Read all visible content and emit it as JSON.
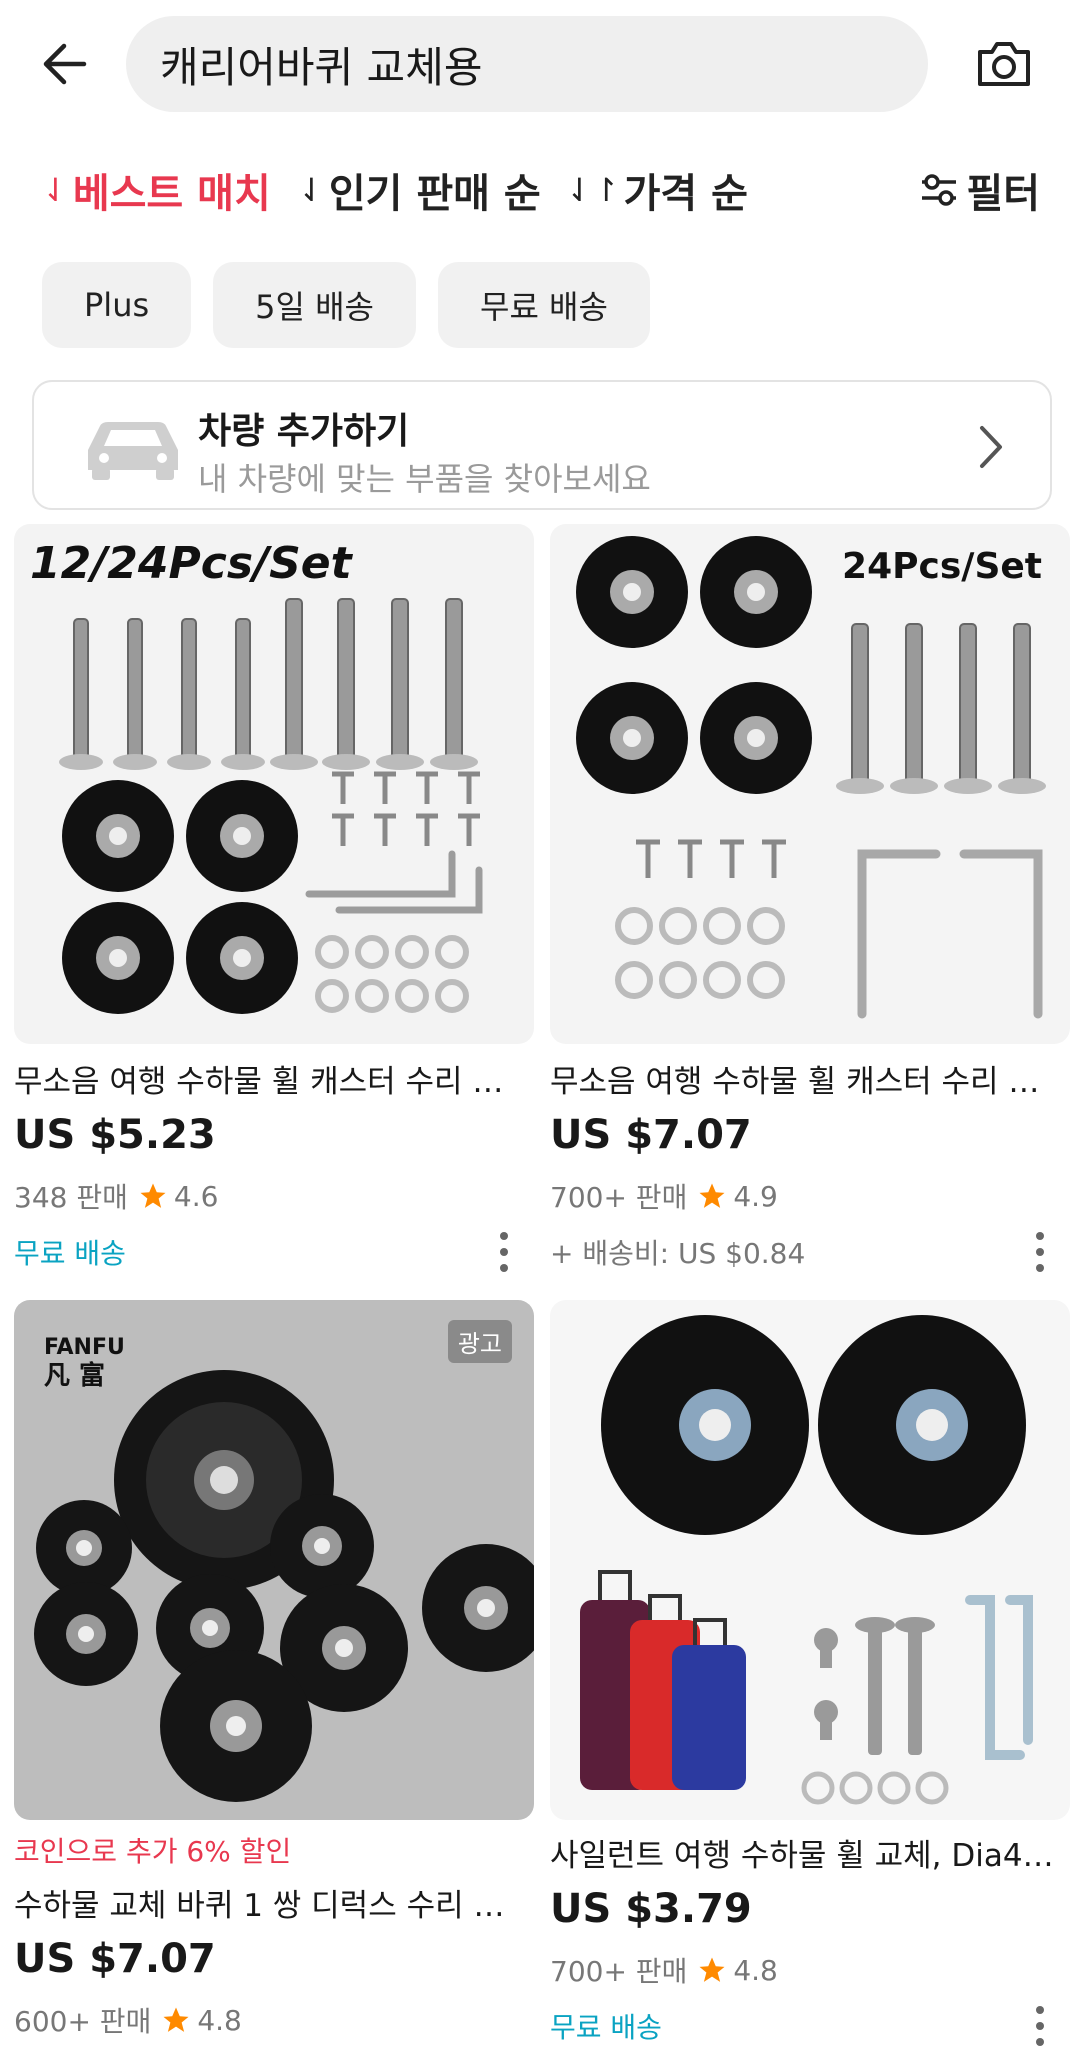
{
  "header": {
    "search_text": "캐리어바퀴 교체용"
  },
  "sort": {
    "best_match": "베스트 매치",
    "popular": "인기 판매 순",
    "price": "가격 순",
    "filter": "필터"
  },
  "chips": [
    "Plus",
    "5일 배송",
    "무료 배송"
  ],
  "vehicle": {
    "title": "차량 추가하기",
    "subtitle": "내 차량에 맞는 부품을 찾아보세요"
  },
  "products": [
    {
      "image_label": "12/24Pcs/Set",
      "title": "무소음 여행 수하물 휠 캐스터 수리 …",
      "price": "US $5.23",
      "sold": "348 판매",
      "rating": "4.6",
      "shipping": "무료 배송"
    },
    {
      "image_label": "24Pcs/Set",
      "title": "무소음 여행 수하물 휠 캐스터 수리 …",
      "price": "US $7.07",
      "sold": "700+ 판매",
      "rating": "4.9",
      "shipping": "+ 배송비: US $0.84"
    },
    {
      "brand_en": "FANFU",
      "brand_cn": "凡 富",
      "ad_badge": "광고",
      "promo": "코인으로 추가 6% 할인",
      "title": "수하물 교체 바퀴 1 쌍 디럭스 수리 …",
      "price": "US $7.07",
      "sold": "600+ 판매",
      "rating": "4.8"
    },
    {
      "title": "사일런트 여행 수하물 휠 교체, Dia4…",
      "price": "US $3.79",
      "sold": "700+ 판매",
      "rating": "4.8",
      "shipping": "무료 배송"
    }
  ],
  "colors": {
    "accent": "#e8384f",
    "shipping": "#0aa3c2",
    "star": "#ff8a00"
  }
}
